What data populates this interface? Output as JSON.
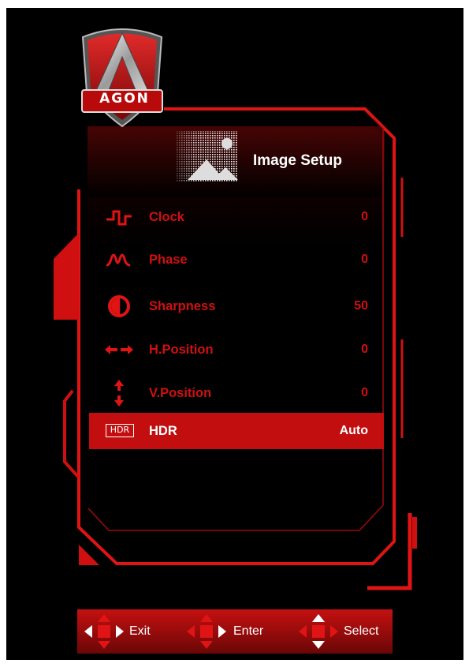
{
  "brand": {
    "logo_text": "AGON"
  },
  "header": {
    "title": "Image Setup",
    "icon": "image-setup-icon"
  },
  "menu": [
    {
      "label": "Clock",
      "value": "0",
      "icon": "clock-waveform-icon"
    },
    {
      "label": "Phase",
      "value": "0",
      "icon": "phase-wave-icon"
    },
    {
      "label": "Sharpness",
      "value": "50",
      "icon": "sharpness-circle-icon"
    },
    {
      "label": "H.Position",
      "value": "0",
      "icon": "horizontal-arrows-icon"
    },
    {
      "label": "V.Position",
      "value": "0",
      "icon": "vertical-arrows-icon"
    },
    {
      "label": "HDR",
      "value": "Auto",
      "icon": "hdr-icon",
      "icon_text": "HDR",
      "selected": true
    }
  ],
  "nav": {
    "exit_label": "Exit",
    "enter_label": "Enter",
    "select_label": "Select"
  },
  "colors": {
    "accent": "#e01414",
    "selected_row": "#c20e0e",
    "background": "#000000",
    "text_inactive": "#d01010"
  }
}
